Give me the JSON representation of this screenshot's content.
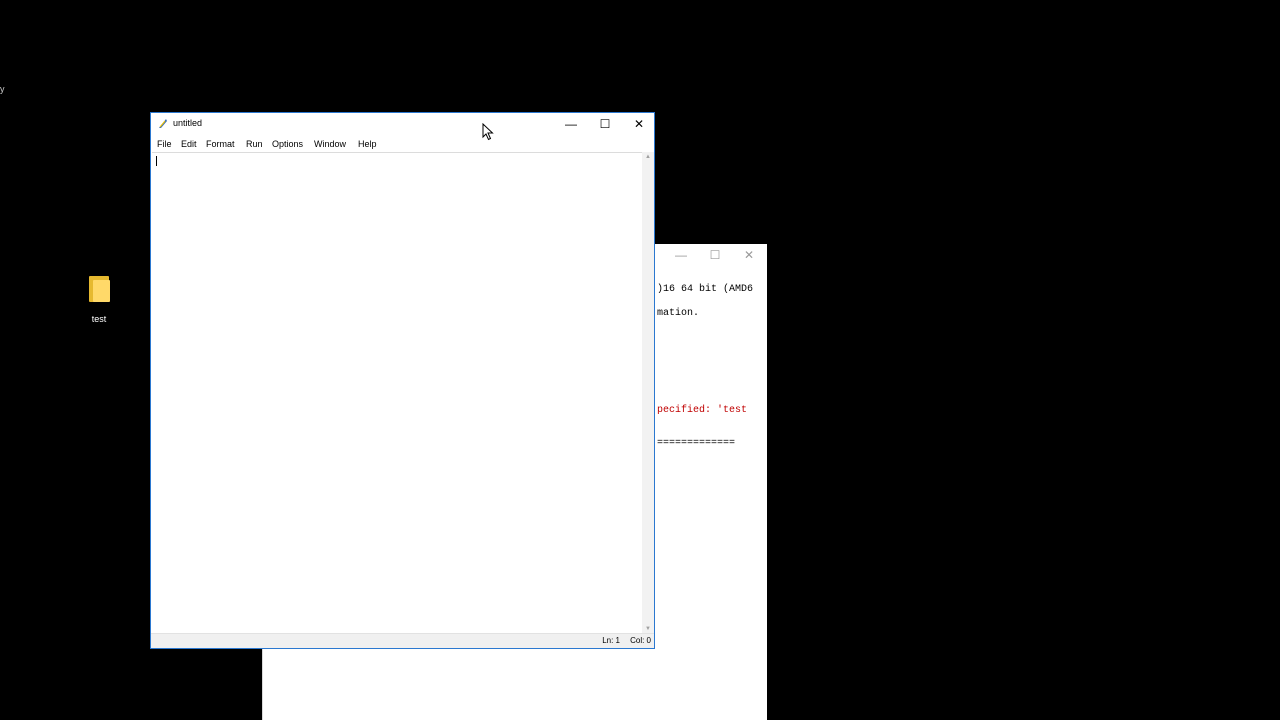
{
  "desktop": {
    "background": "#000000",
    "edge_fragment": "y",
    "icons": [
      {
        "label": "test",
        "icon": "folder-icon"
      }
    ]
  },
  "shell_window": {
    "controls": {
      "minimize": "—",
      "maximize": "☐",
      "close": "✕"
    },
    "lines": [
      {
        "text": ")16 64 bit (AMD6",
        "color": "#000000"
      },
      {
        "text": "mation.",
        "color": "#000000"
      },
      {
        "text": "pecified: 'test",
        "color": "#c00000"
      },
      {
        "text": "=============",
        "color": "#000000"
      }
    ]
  },
  "editor_window": {
    "title": "untitled",
    "controls": {
      "minimize": "—",
      "maximize": "☐",
      "close": "✕"
    },
    "menu": [
      "File",
      "Edit",
      "Format",
      "Run",
      "Options",
      "Window",
      "Help"
    ],
    "status": {
      "line": "Ln: 1",
      "col": "Col: 0"
    },
    "accent": "#2b78d0"
  }
}
